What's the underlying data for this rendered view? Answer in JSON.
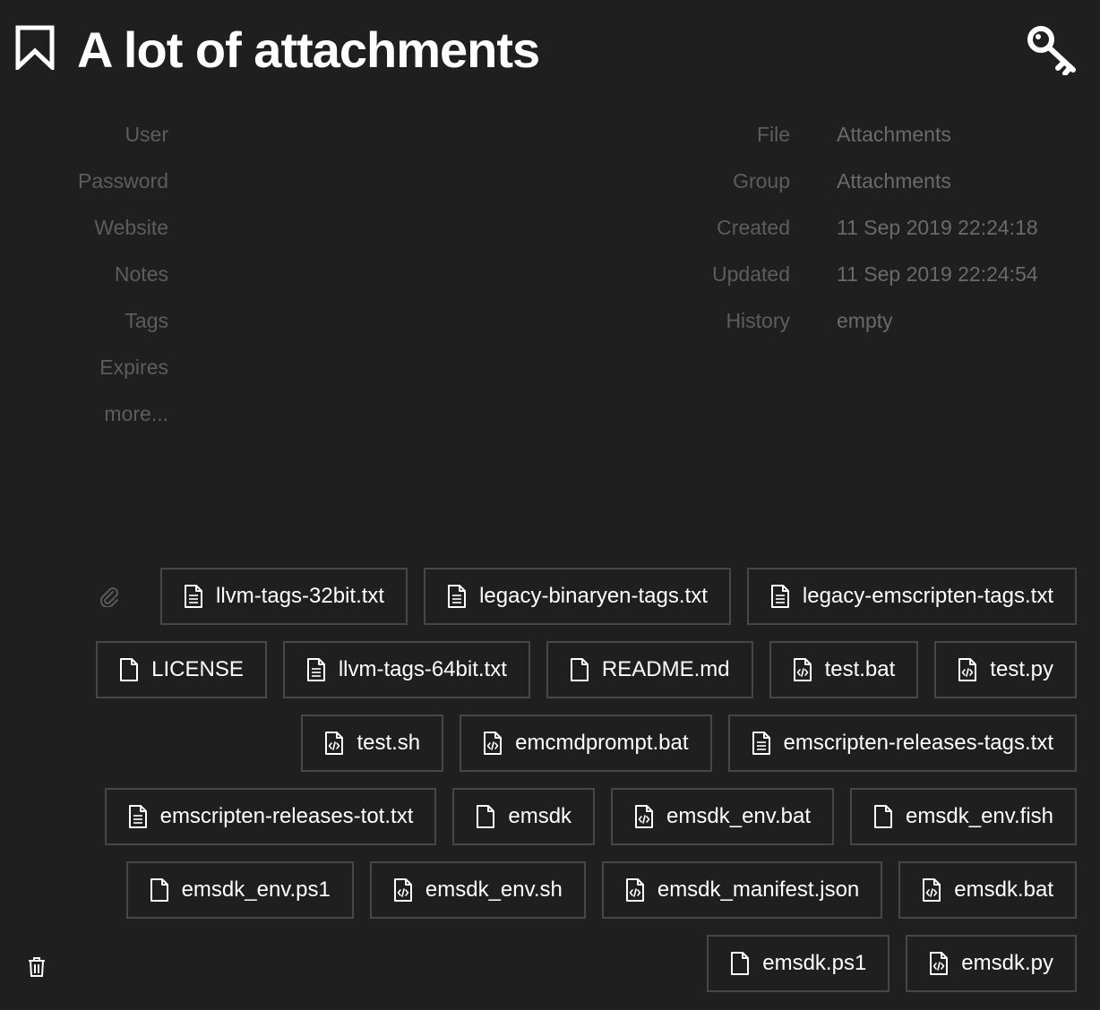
{
  "entry": {
    "title": "A lot of attachments"
  },
  "fields_left": [
    "User",
    "Password",
    "Website",
    "Notes",
    "Tags",
    "Expires",
    "more..."
  ],
  "fields_right": [
    {
      "label": "File",
      "value": "Attachments"
    },
    {
      "label": "Group",
      "value": "Attachments"
    },
    {
      "label": "Created",
      "value": "11 Sep 2019 22:24:18"
    },
    {
      "label": "Updated",
      "value": "11 Sep 2019 22:24:54"
    },
    {
      "label": "History",
      "value": "empty"
    }
  ],
  "icons": {
    "bookmark": "bookmark-icon",
    "key": "key-icon",
    "paperclip": "paperclip-icon",
    "trash": "trash-icon"
  },
  "attachments": [
    {
      "name": "llvm-tags-32bit.txt",
      "icon": "file-text-icon"
    },
    {
      "name": "legacy-binaryen-tags.txt",
      "icon": "file-text-icon"
    },
    {
      "name": "legacy-emscripten-tags.txt",
      "icon": "file-text-icon"
    },
    {
      "name": "LICENSE",
      "icon": "file-icon"
    },
    {
      "name": "llvm-tags-64bit.txt",
      "icon": "file-text-icon"
    },
    {
      "name": "README.md",
      "icon": "file-icon"
    },
    {
      "name": "test.bat",
      "icon": "file-code-icon"
    },
    {
      "name": "test.py",
      "icon": "file-code-icon"
    },
    {
      "name": "test.sh",
      "icon": "file-code-icon"
    },
    {
      "name": "emcmdprompt.bat",
      "icon": "file-code-icon"
    },
    {
      "name": "emscripten-releases-tags.txt",
      "icon": "file-text-icon"
    },
    {
      "name": "emscripten-releases-tot.txt",
      "icon": "file-text-icon"
    },
    {
      "name": "emsdk",
      "icon": "file-icon"
    },
    {
      "name": "emsdk_env.bat",
      "icon": "file-code-icon"
    },
    {
      "name": "emsdk_env.fish",
      "icon": "file-icon"
    },
    {
      "name": "emsdk_env.ps1",
      "icon": "file-icon"
    },
    {
      "name": "emsdk_env.sh",
      "icon": "file-code-icon"
    },
    {
      "name": "emsdk_manifest.json",
      "icon": "file-code-icon"
    },
    {
      "name": "emsdk.bat",
      "icon": "file-code-icon"
    },
    {
      "name": "emsdk.ps1",
      "icon": "file-icon"
    },
    {
      "name": "emsdk.py",
      "icon": "file-code-icon"
    }
  ],
  "colors": {
    "background": "#1f1f1f",
    "label": "#5d5d5d",
    "value": "#6a6a6a",
    "border": "#474747",
    "text": "#ffffff"
  }
}
